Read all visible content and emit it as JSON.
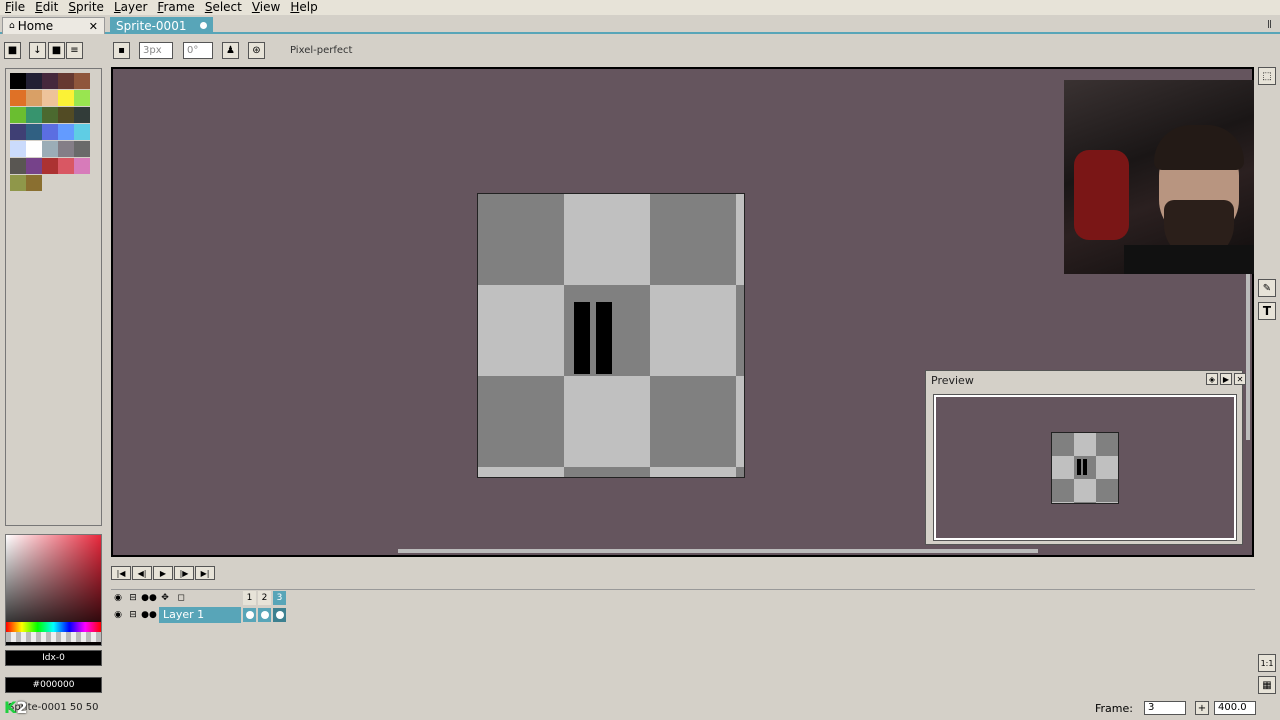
{
  "menu": [
    "File",
    "Edit",
    "Sprite",
    "Layer",
    "Frame",
    "Select",
    "View",
    "Help"
  ],
  "tabs": [
    {
      "label": "Home"
    },
    {
      "label": "Sprite-0001"
    }
  ],
  "toolbar": {
    "brush_size_placeholder": "3px",
    "brush_angle_placeholder": "0°",
    "pixel_perfect_label": "Pixel-perfect"
  },
  "palette": {
    "colors": [
      [
        "#000000",
        "#222034",
        "#45283c",
        "#663931",
        "#8f563b"
      ],
      [
        "#df7126",
        "#d9a066",
        "#eec39a",
        "#fbf236",
        "#99e550"
      ],
      [
        "#6abe30",
        "#37946e",
        "#4b692f",
        "#524b24",
        "#323c39"
      ],
      [
        "#3f3f74",
        "#306082",
        "#5b6ee1",
        "#639bff",
        "#5fcde4"
      ],
      [
        "#cbdbfc",
        "#ffffff",
        "#9badb7",
        "#847e87",
        "#696a6a"
      ],
      [
        "#595652",
        "#76428a",
        "#ac3232",
        "#d95763",
        "#d77bba"
      ],
      [
        "#8f974a",
        "#8a6f30"
      ]
    ]
  },
  "color_index_label": "Idx-0",
  "color_hex_label": "#000000",
  "preview": {
    "title": "Preview"
  },
  "layers": [
    {
      "name": "Layer 1"
    }
  ],
  "frames": [
    "1",
    "2",
    "3"
  ],
  "status": {
    "left_text": "Sprite-0001   50 50",
    "frame_label": "Frame:",
    "frame_value": "3",
    "zoom_value": "400.0"
  },
  "colors": {
    "canvas_bg": "#65555e",
    "accent": "#58a5b8",
    "checker_dark": "#808080",
    "checker_light": "#c0c0c0"
  }
}
